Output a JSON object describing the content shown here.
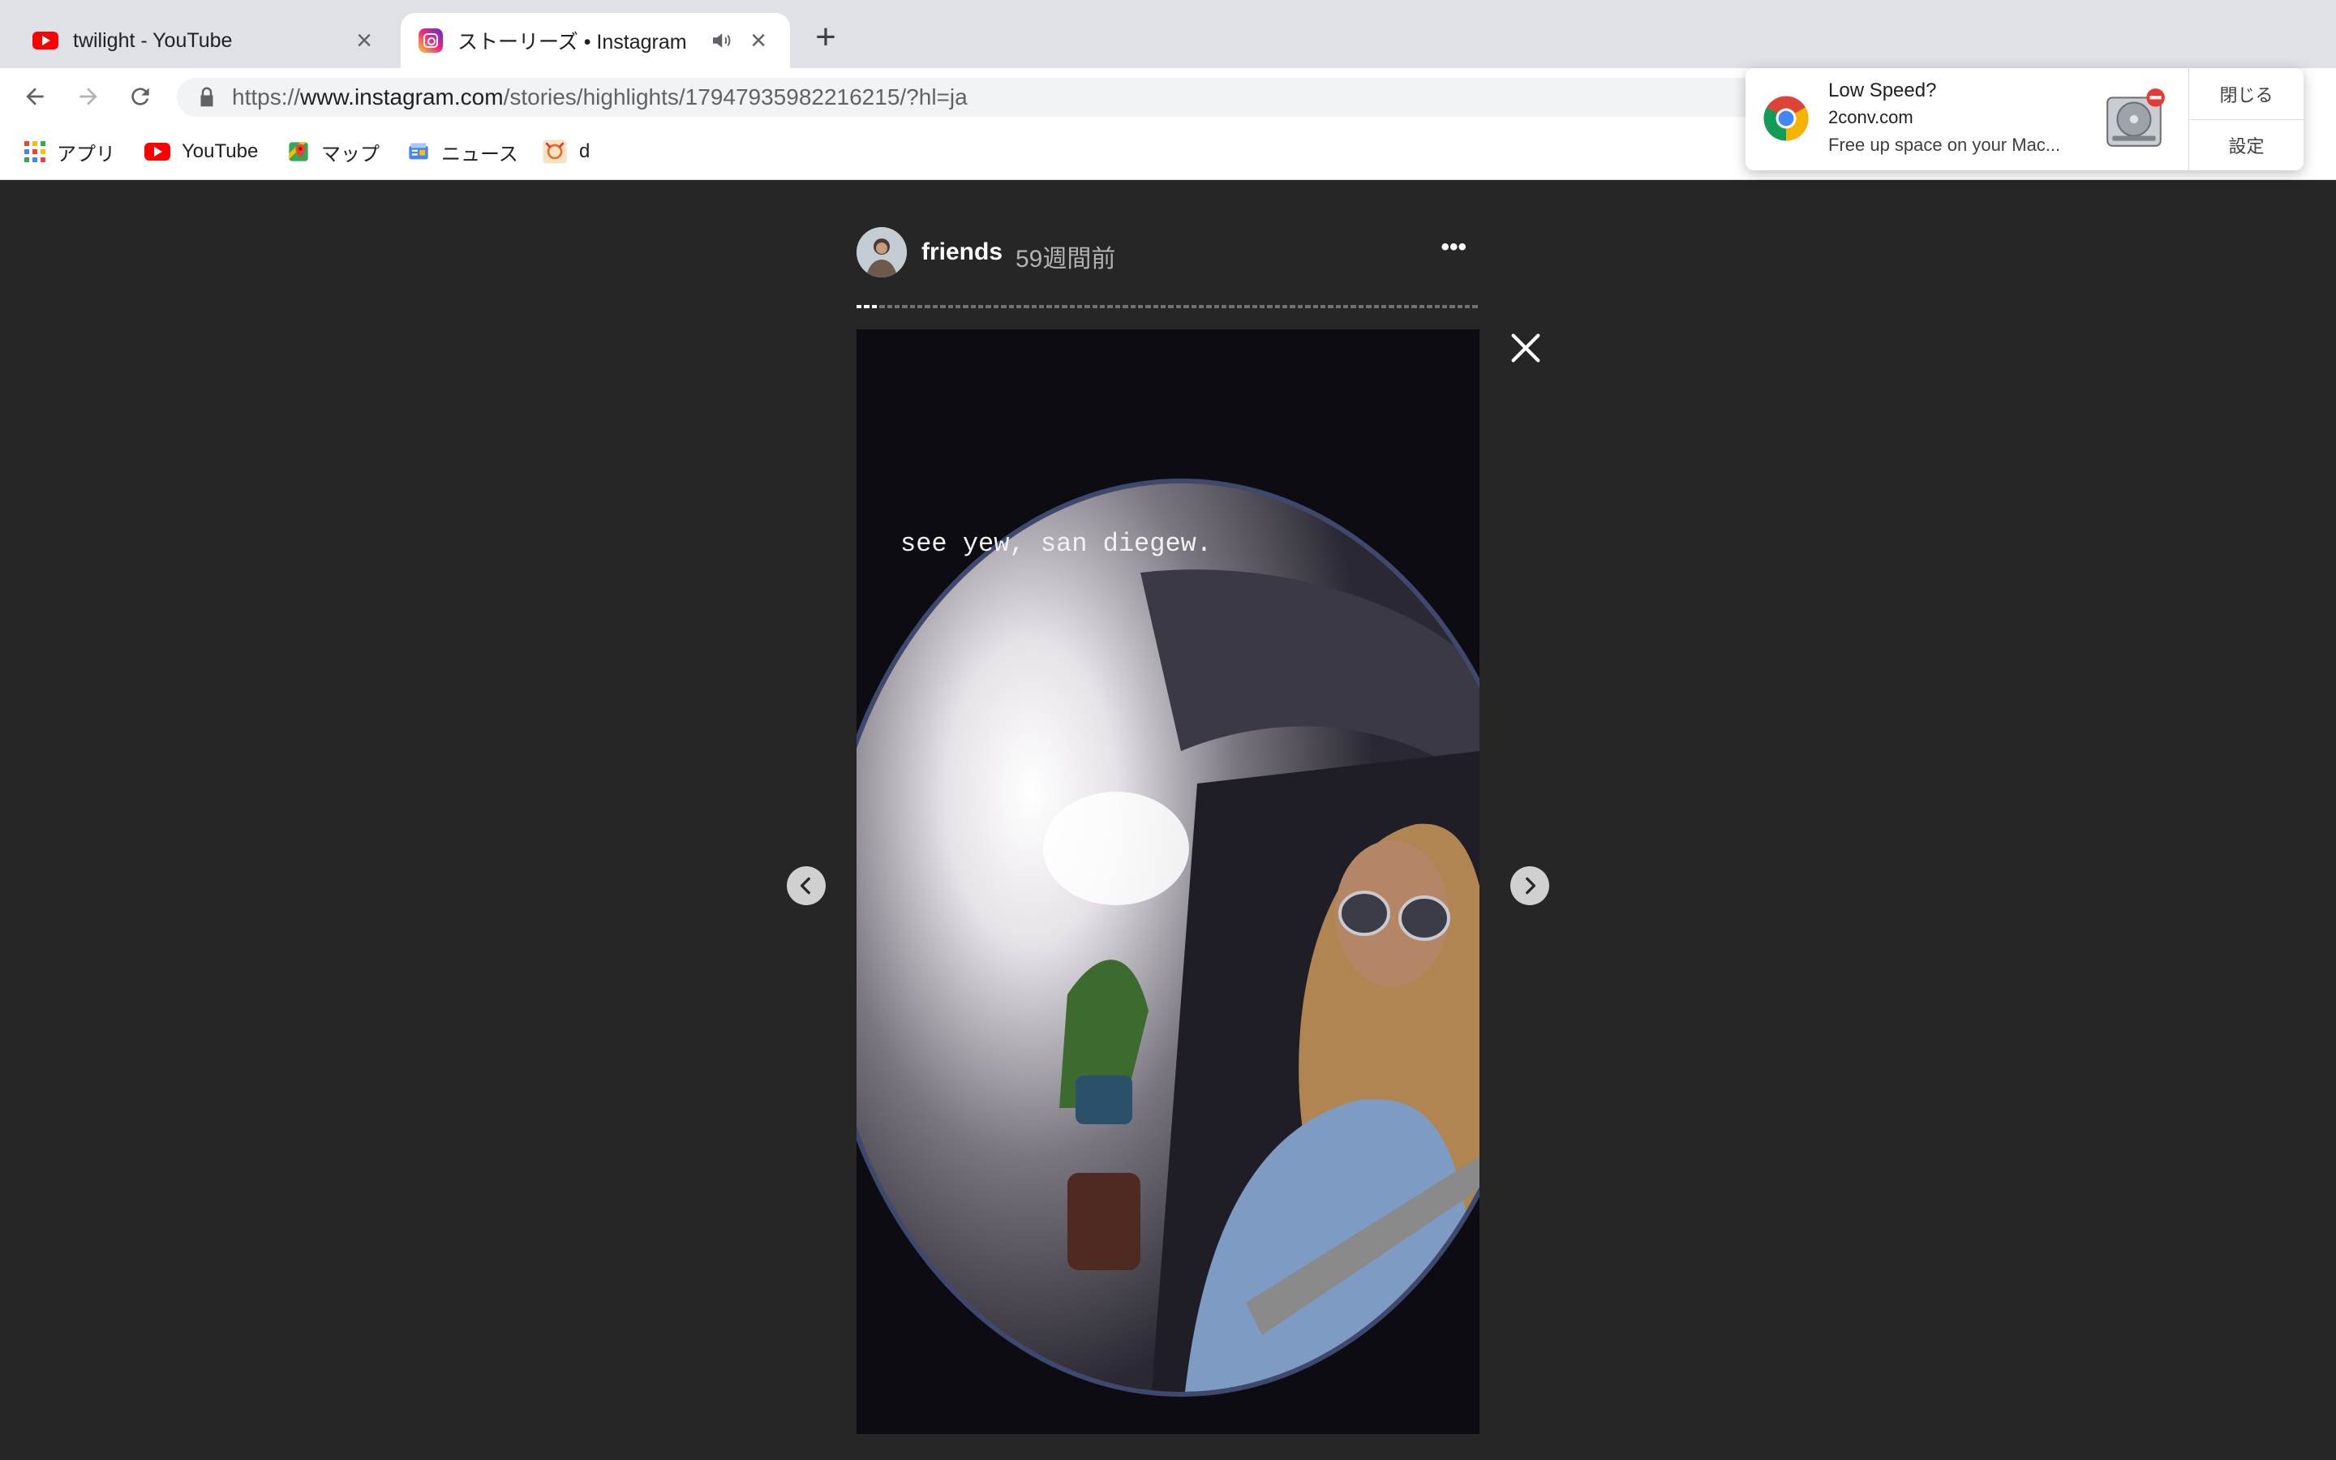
{
  "tabs": [
    {
      "title": "twilight - YouTube",
      "favicon": "youtube-icon",
      "close": "×"
    },
    {
      "title": "ストーリーズ • Instagram",
      "favicon": "instagram-icon",
      "close": "×",
      "audio": "speaker-icon"
    }
  ],
  "new_tab": "+",
  "omnibox": {
    "url_scheme": "https://",
    "url_host": "www.instagram.com",
    "url_path": "/stories/highlights/17947935982216215/?hl=ja"
  },
  "bookmarks": [
    {
      "label": "アプリ",
      "icon": "apps-grid-icon"
    },
    {
      "label": "YouTube",
      "icon": "youtube-icon"
    },
    {
      "label": "マップ",
      "icon": "maps-icon"
    },
    {
      "label": "ニュース",
      "icon": "news-icon"
    },
    {
      "label": "d",
      "icon": "bookmark-favicon"
    }
  ],
  "notification": {
    "title": "Low Speed?",
    "site": "2conv.com",
    "body": "Free up space on your Mac...",
    "close_label": "閉じる",
    "settings_label": "設定"
  },
  "story": {
    "username": "friends",
    "time_ago": "59週間前",
    "more_glyph": "•••",
    "caption": "see yew, san diegew."
  },
  "colors": {
    "background": "#262626",
    "tabstrip": "#dee1e6",
    "youtube_red": "#ff0000"
  }
}
